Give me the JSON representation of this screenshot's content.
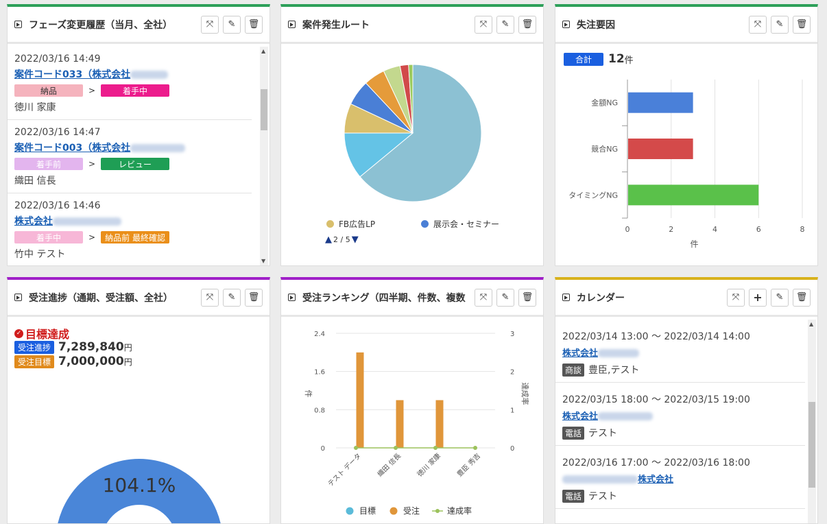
{
  "phase_history": {
    "title": "フェーズ変更履歴（当月、全社）",
    "items": [
      {
        "time": "2022/03/16 14:49",
        "link": "案件コード033（株式会社",
        "from": "納品",
        "to": "着手中",
        "person": "徳川 家康"
      },
      {
        "time": "2022/03/16 14:47",
        "link": "案件コード003（株式会社",
        "from": "着手前",
        "to": "レビュー",
        "person": "織田 信長"
      },
      {
        "time": "2022/03/16 14:46",
        "link": "株式会社",
        "from": "着手中",
        "to": "納品前 最終確認",
        "person": "竹中 テスト"
      }
    ],
    "colors": {
      "納品": "#f5b3bd",
      "着手中": "#ec1c8c",
      "着手前": "#e3b5ee",
      "レビュー": "#1f9e55",
      "納品前 最終確認": "#ea8f1a"
    }
  },
  "lead_source": {
    "title": "案件発生ルート",
    "legend": [
      {
        "label": "FB広告LP",
        "color": "#d9bf6c"
      },
      {
        "label": "展示会・セミナー",
        "color": "#4a7fd6"
      }
    ],
    "pager": "2 / 5"
  },
  "lost_reason": {
    "title": "失注要因",
    "total_label": "合計",
    "total_value": "12",
    "total_unit": "件"
  },
  "order_progress": {
    "title": "受注進捗（通期、受注額、全社）",
    "status": "目標達成",
    "actual_label": "受注進捗",
    "actual_value": "7,289,840",
    "target_label": "受注目標",
    "target_value": "7,000,000",
    "currency": "円",
    "percent": "104.1%"
  },
  "ranking": {
    "title": "受注ランキング（四半期、件数、複数"
  },
  "calendar": {
    "title": "カレンダー",
    "events": [
      {
        "time": "2022/03/14 13:00 〜 2022/03/14 14:00",
        "link": "株式会社",
        "category": "商談",
        "attendees": "豊臣,テスト"
      },
      {
        "time": "2022/03/15 18:00 〜 2022/03/15 19:00",
        "link": "株式会社",
        "category": "電話",
        "attendees": "テスト"
      },
      {
        "time": "2022/03/16 17:00 〜 2022/03/16 18:00",
        "link": "株式会社",
        "category": "電話",
        "attendees": "テスト"
      }
    ]
  },
  "chart_data": [
    {
      "type": "pie",
      "title": "",
      "series": [
        {
          "name": "",
          "values": [
            64,
            11,
            7,
            6,
            5,
            4,
            2,
            1
          ]
        }
      ],
      "categories": [
        "",
        "",
        "FB広告LP",
        "展示会・セミナー",
        "",
        "",
        "",
        ""
      ],
      "colors": [
        "#8cc1d3",
        "#64c3e6",
        "#d9bf6c",
        "#4a7fd6",
        "#e59b3a",
        "#c3d88e",
        "#d14a4a",
        "#9bcb5e"
      ]
    },
    {
      "type": "bar",
      "orientation": "horizontal",
      "categories": [
        "金額NG",
        "競合NG",
        "タイミングNG"
      ],
      "values": [
        3,
        3,
        6
      ],
      "colors": [
        "#4a80d9",
        "#d44a4a",
        "#5ac14a"
      ],
      "xlabel": "件",
      "xlim": [
        0,
        8
      ],
      "xticks": [
        "0",
        "2",
        "4",
        "6",
        "8"
      ],
      "grid": true
    },
    {
      "type": "pie",
      "subtype": "gauge",
      "values": [
        104.1
      ],
      "colors": [
        "#4a86d8"
      ],
      "label": "104.1%"
    },
    {
      "type": "bar",
      "categories": [
        "テスト データ",
        "織田 信長",
        "徳川 家康",
        "豊臣 秀吉"
      ],
      "series": [
        {
          "name": "目標",
          "values": [
            0,
            0,
            0,
            0
          ],
          "color": "#5bbbd9",
          "kind": "bar"
        },
        {
          "name": "受注",
          "values": [
            2,
            1,
            1,
            0
          ],
          "color": "#e0963a",
          "kind": "bar"
        },
        {
          "name": "達成率",
          "values": [
            0,
            0,
            0,
            0
          ],
          "color": "#9cc25c",
          "kind": "line"
        }
      ],
      "ylabel": "件",
      "ylim": [
        0,
        2.4
      ],
      "yticks": [
        "0",
        "0.8",
        "1.6",
        "2.4"
      ],
      "y2label": "達成率",
      "y2lim": [
        0,
        3
      ],
      "y2ticks": [
        "0",
        "1",
        "2",
        "3"
      ],
      "legend": "bottom"
    }
  ]
}
